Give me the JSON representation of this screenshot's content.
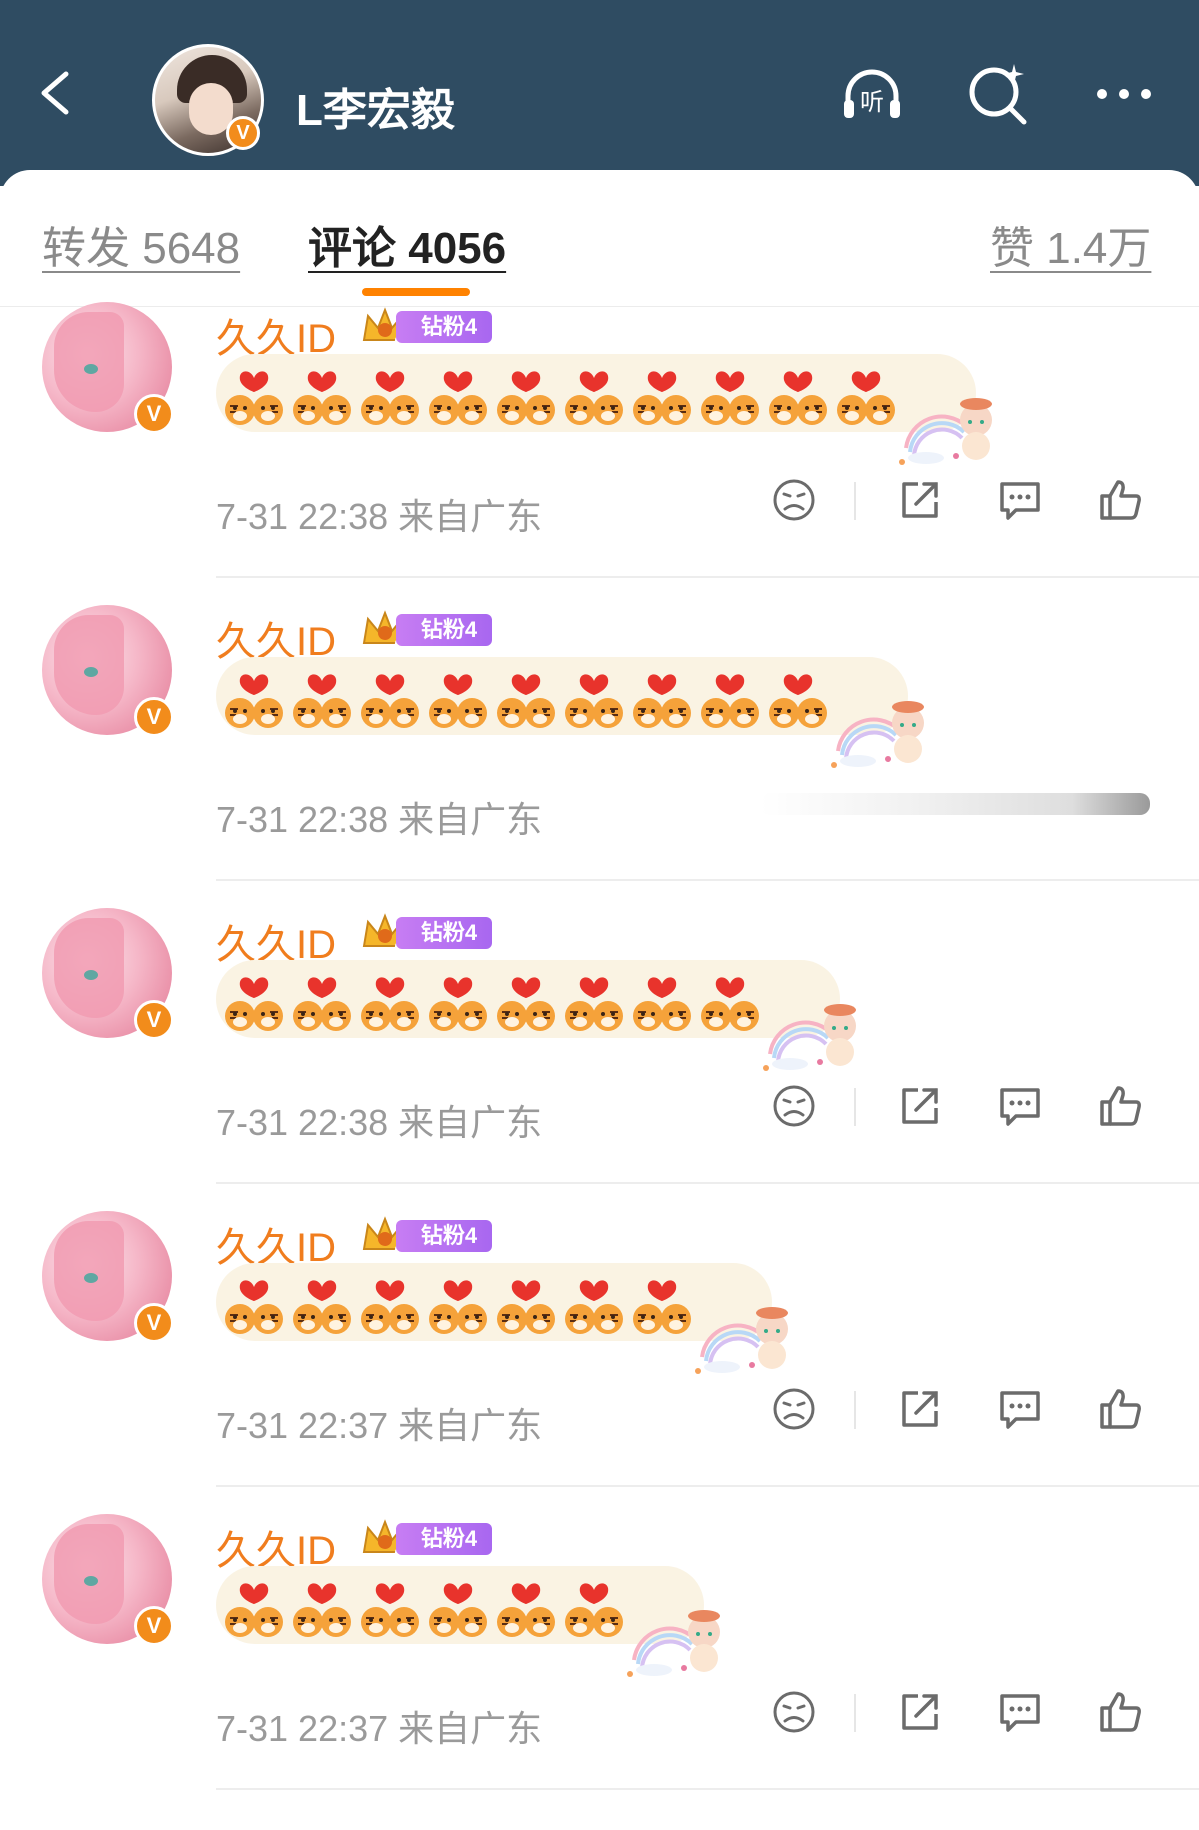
{
  "header": {
    "title": "L李宏毅",
    "verified_badge": "V",
    "icons": [
      "back-icon",
      "listen-icon",
      "search-icon",
      "more-icon"
    ],
    "listen_label": "听"
  },
  "tabs": [
    {
      "label": "转发 5648",
      "active": false
    },
    {
      "label": "评论 4056",
      "active": true
    },
    {
      "label": "赞 1.4万",
      "active": false
    }
  ],
  "colors": {
    "header_bg": "#2f4c62",
    "accent_orange": "#ff8200",
    "username_orange": "#f07d1e",
    "badge_purple": "#b070f0"
  },
  "comments": [
    {
      "username": "久久ID",
      "badge_label": "钻粉4",
      "emoji_count": 10,
      "time": "7-31 22:38",
      "location": "来自广东",
      "actions_visible": true
    },
    {
      "username": "久久ID",
      "badge_label": "钻粉4",
      "emoji_count": 9,
      "time": "7-31 22:38",
      "location": "来自广东",
      "actions_visible": false
    },
    {
      "username": "久久ID",
      "badge_label": "钻粉4",
      "emoji_count": 8,
      "time": "7-31 22:38",
      "location": "来自广东",
      "actions_visible": true
    },
    {
      "username": "久久ID",
      "badge_label": "钻粉4",
      "emoji_count": 7,
      "time": "7-31 22:37",
      "location": "来自广东",
      "actions_visible": true
    },
    {
      "username": "久久ID",
      "badge_label": "钻粉4",
      "emoji_count": 6,
      "time": "7-31 22:37",
      "location": "来自广东",
      "actions_visible": true
    }
  ]
}
